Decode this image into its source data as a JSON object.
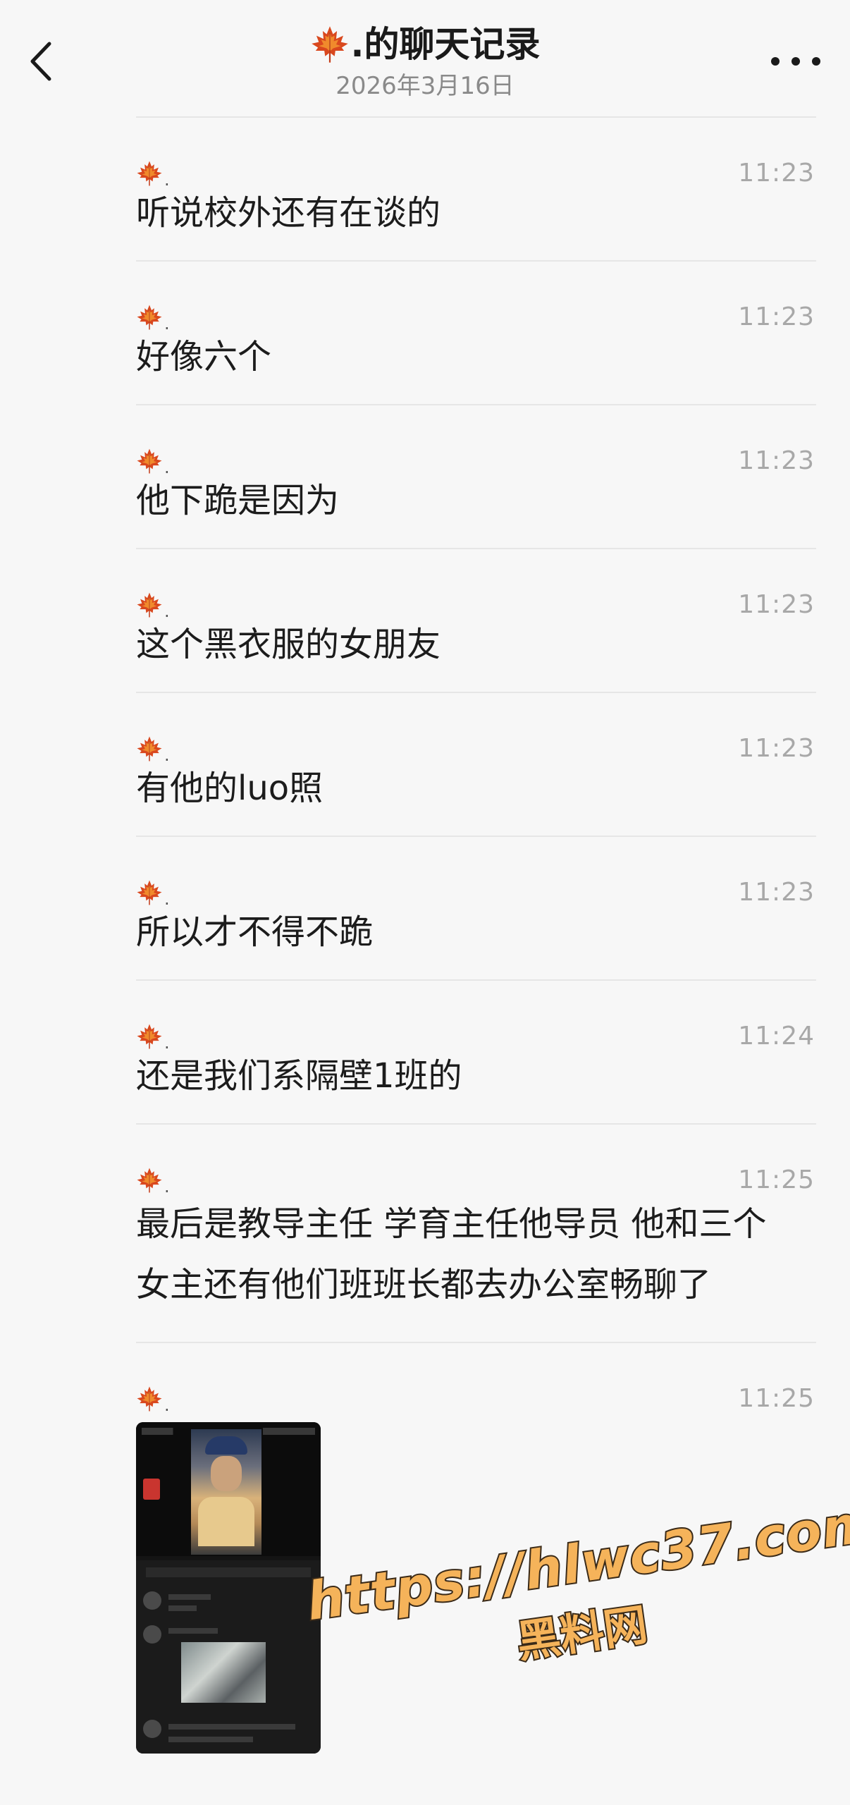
{
  "header": {
    "title": ".的聊天记录",
    "subtitle": "2026年3月16日"
  },
  "sender_suffix": ".",
  "messages": [
    {
      "time": "11:23",
      "text": "听说校外还有在谈的"
    },
    {
      "time": "11:23",
      "text": "好像六个"
    },
    {
      "time": "11:23",
      "text": "他下跪是因为"
    },
    {
      "time": "11:23",
      "text": "这个黑衣服的女朋友"
    },
    {
      "time": "11:23",
      "text": "有他的luo照"
    },
    {
      "time": "11:23",
      "text": "所以才不得不跪"
    },
    {
      "time": "11:24",
      "text": "还是我们系隔壁1班的"
    },
    {
      "time": "11:25",
      "text": "最后是教导主任 学育主任他导员 他和三个\n女主还有他们班班长都去办公室畅聊了"
    },
    {
      "time": "11:25",
      "type": "image"
    }
  ],
  "watermark": {
    "url": "https://hlwc37.com",
    "name": "黑料网"
  },
  "icons": {
    "back": "chevron-left-icon",
    "more": "more-dots-icon",
    "sender_avatar": "maple-leaf-icon"
  },
  "colors": {
    "background": "#f7f7f7",
    "divider": "#e6e6e6",
    "time": "#a8a8a8",
    "watermark": "#f5b35a"
  }
}
